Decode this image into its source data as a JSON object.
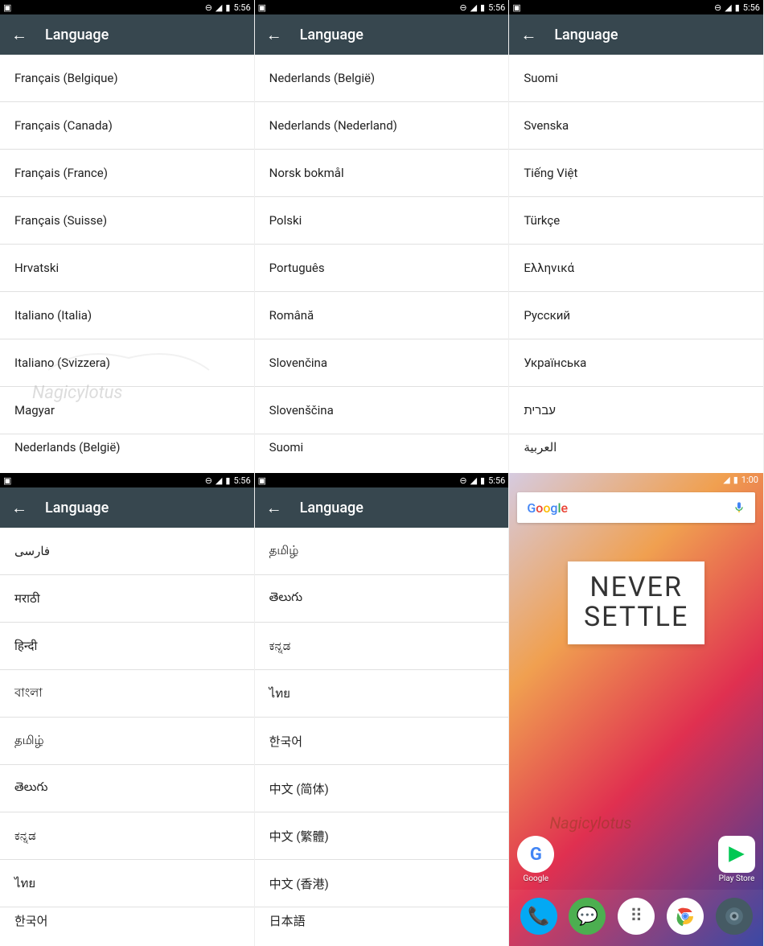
{
  "status": {
    "time": "5:56"
  },
  "appbar_title": "Language",
  "watermark": "Nagicylotus",
  "panels": [
    {
      "languages": [
        "Français (Belgique)",
        "Français (Canada)",
        "Français (France)",
        "Français (Suisse)",
        "Hrvatski",
        "Italiano (Italia)",
        "Italiano (Svizzera)",
        "Magyar",
        "Nederlands (België)"
      ]
    },
    {
      "languages": [
        "Nederlands (België)",
        "Nederlands (Nederland)",
        "Norsk bokmål",
        "Polski",
        "Português",
        "Română",
        "Slovenčina",
        "Slovenščina",
        "Suomi"
      ]
    },
    {
      "languages": [
        "Suomi",
        "Svenska",
        "Tiếng Việt",
        "Türkçe",
        "Ελληνικά",
        "Русский",
        "Українська",
        "עברית",
        "العربية"
      ]
    },
    {
      "languages": [
        "فارسی",
        "मराठी",
        "हिन्दी",
        "বাংলা",
        "தமிழ்",
        "తెలుగు",
        "ಕನ್ನಡ",
        "ไทย",
        "한국어"
      ]
    },
    {
      "languages": [
        "தமிழ்",
        "తెలుగు",
        "ಕನ್ನಡ",
        "ไทย",
        "한국어",
        "中文 (简体)",
        "中文 (繁體)",
        "中文 (香港)",
        "日本語"
      ]
    }
  ],
  "home": {
    "time": "1:00",
    "search_brand": "Google",
    "banner_line1": "NEVER",
    "banner_line2": "SETTLE",
    "app_shortcuts": [
      {
        "name": "Google",
        "icon": "G"
      },
      {
        "name": "Play Store",
        "icon": "▶"
      }
    ],
    "dock": [
      {
        "name": "Phone",
        "icon": "📞"
      },
      {
        "name": "Messages",
        "icon": "💬"
      },
      {
        "name": "Apps",
        "icon": "⋮⋮⋮"
      },
      {
        "name": "Chrome",
        "icon": "◉"
      },
      {
        "name": "Camera",
        "icon": "📷"
      }
    ]
  }
}
